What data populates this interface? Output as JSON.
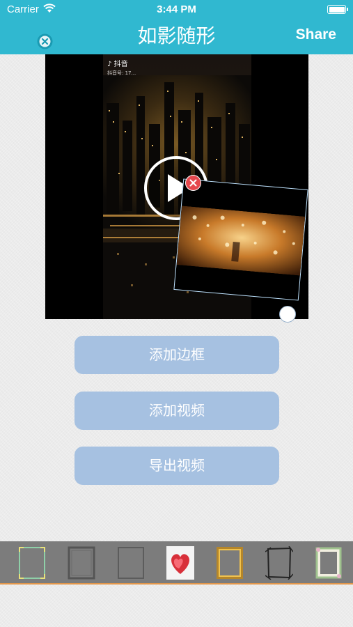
{
  "status_bar": {
    "carrier": "Carrier",
    "time": "3:44 PM"
  },
  "nav": {
    "title": "如影随形",
    "share_label": "Share",
    "close_icon": "close-circle-icon"
  },
  "video": {
    "watermark_app": "抖音",
    "watermark_id": "抖音号: 17...",
    "play_icon": "play-icon",
    "overlay_delete_icon": "delete-badge-icon"
  },
  "actions": {
    "add_frame": "添加边框",
    "add_video": "添加视频",
    "export_video": "导出视频"
  },
  "frames": [
    {
      "name": "frame-green-corners"
    },
    {
      "name": "frame-dark-ornate"
    },
    {
      "name": "frame-plain-gray"
    },
    {
      "name": "frame-red-hearts"
    },
    {
      "name": "frame-gold-ornate"
    },
    {
      "name": "frame-branches"
    },
    {
      "name": "frame-floral"
    }
  ],
  "colors": {
    "header": "#30b8d0",
    "button": "#a6c1e1",
    "frame_bar": "#7c7c7c",
    "accent_line": "#e2964a",
    "delete_red": "#e5484d"
  }
}
